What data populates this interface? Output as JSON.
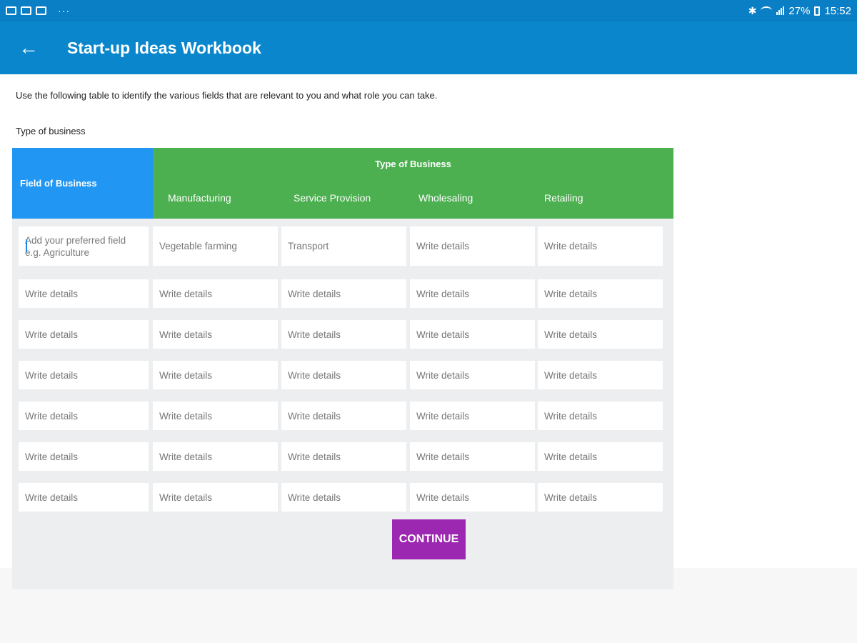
{
  "status_bar": {
    "icons_left": [
      "image-icon",
      "gallery-icon",
      "email-icon"
    ],
    "more": "···",
    "battery": "27%",
    "time": "15:52"
  },
  "app_bar": {
    "title": "Start-up Ideas Workbook"
  },
  "intro_text": "Use the following table to identify the various fields that are relevant to you and what role you can take.",
  "subheading": "Type of business",
  "table": {
    "field_header": "Field of Business",
    "type_header": "Type of Business",
    "columns": [
      "Manufacturing",
      "Service Provision",
      "Wholesaling",
      "Retailing"
    ],
    "rows": [
      [
        "Add your preferred field e.g. Agriculture",
        "Vegetable farming",
        "Transport",
        "Write details",
        "Write details"
      ],
      [
        "Write details",
        "Write details",
        "Write details",
        "Write details",
        "Write details"
      ],
      [
        "Write details",
        "Write details",
        "Write details",
        "Write details",
        "Write details"
      ],
      [
        "Write details",
        "Write details",
        "Write details",
        "Write details",
        "Write details"
      ],
      [
        "Write details",
        "Write details",
        "Write details",
        "Write details",
        "Write details"
      ],
      [
        "Write details",
        "Write details",
        "Write details",
        "Write details",
        "Write details"
      ],
      [
        "Write details",
        "Write details",
        "Write details",
        "Write details",
        "Write details"
      ]
    ]
  },
  "continue_label": "CONTINUE",
  "colors": {
    "status_bar": "#0a7fc6",
    "app_bar": "#0a87cc",
    "field_header": "#2196f3",
    "type_header": "#4caf50",
    "continue_button": "#9c27b0"
  }
}
